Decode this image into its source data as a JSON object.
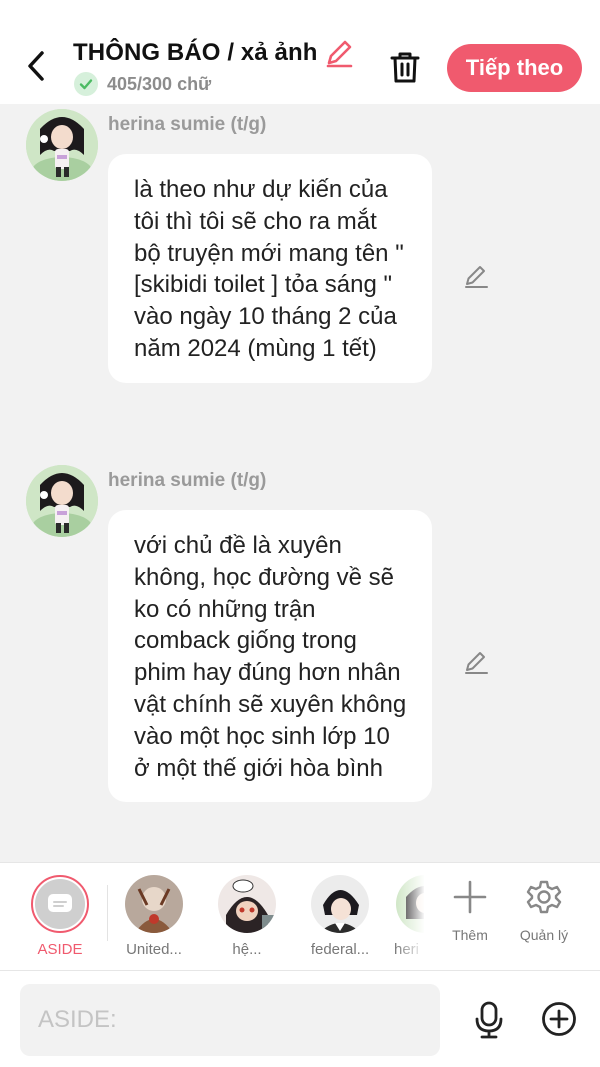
{
  "header": {
    "title": "THÔNG BÁO / xả ảnh",
    "word_count": "405/300 chữ",
    "next_label": "Tiếp theo"
  },
  "messages": [
    {
      "author": "herina sumie (t/g)",
      "text": "là theo như dự kiến của tôi thì tôi sẽ cho ra mắt bộ truyện mới mang tên \"[skibidi toilet ] tỏa sáng \" vào ngày 10 tháng 2 của năm 2024 (mùng 1 tết)"
    },
    {
      "author": "herina sumie (t/g)",
      "text": "với chủ đề là xuyên không, học đường về sẽ ko có những trận comback giống trong phim hay đúng hơn nhân vật chính sẽ xuyên không vào một học sinh lớp 10 ở một thế giới hòa bình"
    }
  ],
  "characters": [
    {
      "label": "ASIDE"
    },
    {
      "label": "United..."
    },
    {
      "label": "hệ..."
    },
    {
      "label": "federal..."
    },
    {
      "label": "heri"
    }
  ],
  "tools": {
    "add_label": "Thêm",
    "manage_label": "Quản lý"
  },
  "input": {
    "placeholder": "ASIDE:"
  },
  "colors": {
    "accent": "#f05a6e",
    "background": "#f2f2f2",
    "bubble": "#ffffff",
    "check_green": "#4cbb63"
  }
}
